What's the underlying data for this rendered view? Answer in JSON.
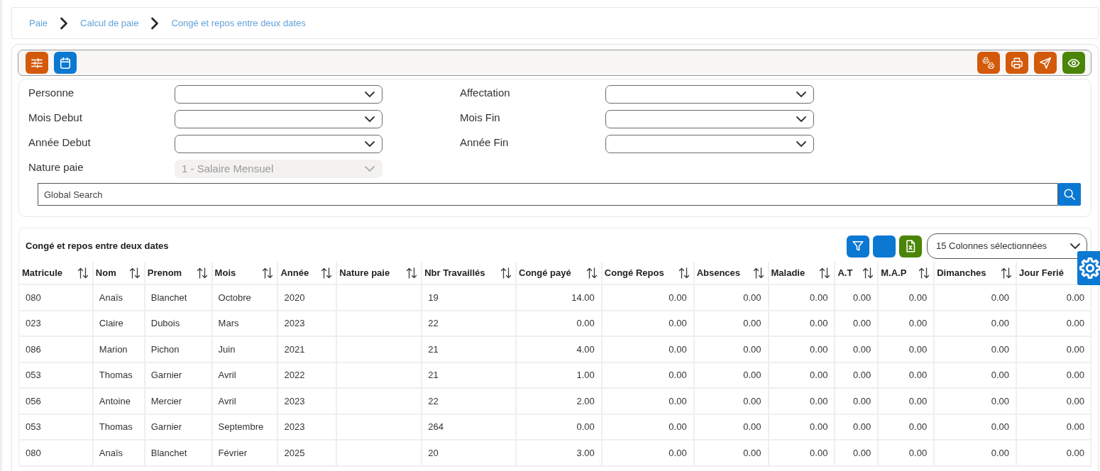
{
  "breadcrumb": [
    {
      "label": "Paie"
    },
    {
      "label": "Calcul de paie"
    },
    {
      "label": "Congé et repos entre deux dates"
    }
  ],
  "toolbar": {
    "left": [
      {
        "kind": "sliders"
      },
      {
        "kind": "calendar"
      }
    ],
    "right": [
      {
        "kind": "print-multi"
      },
      {
        "kind": "print"
      },
      {
        "kind": "send"
      },
      {
        "kind": "view"
      }
    ]
  },
  "filters": [
    {
      "label": "Personne",
      "disabled": false
    },
    {
      "label": "Affectation",
      "disabled": false
    },
    {
      "label": "Mois Debut",
      "disabled": false
    },
    {
      "label": "Mois Fin",
      "disabled": false
    },
    {
      "label": "Année Debut",
      "disabled": false
    },
    {
      "label": "Année Fin",
      "disabled": false
    },
    {
      "label": "Nature paie",
      "value": "1 - Salaire Mensuel",
      "disabled": true
    }
  ],
  "search": {
    "placeholder": "Global Search"
  },
  "table": {
    "title": "Congé et repos entre deux dates",
    "tools": [
      {
        "kind": "filter"
      },
      {
        "kind": "blank"
      },
      {
        "kind": "excel"
      }
    ],
    "column_picker": {
      "value": "15 Colonnes sélectionnées"
    },
    "columns": [
      {
        "label": "Matricule",
        "kind": "text",
        "sortable": true
      },
      {
        "label": "Nom",
        "kind": "text",
        "sortable": true
      },
      {
        "label": "Prenom",
        "kind": "text",
        "sortable": true
      },
      {
        "label": "Mois",
        "kind": "text",
        "sortable": true
      },
      {
        "label": "Année",
        "kind": "text",
        "sortable": true
      },
      {
        "label": "Nature paie",
        "kind": "text",
        "sortable": true
      },
      {
        "label": "Nbr Travaillés",
        "kind": "text",
        "sortable": true
      },
      {
        "label": "Congé payé",
        "kind": "number",
        "sortable": true
      },
      {
        "label": "Congé Repos",
        "kind": "number",
        "sortable": true
      },
      {
        "label": "Absences",
        "kind": "number",
        "sortable": true
      },
      {
        "label": "Maladie",
        "kind": "number",
        "sortable": true
      },
      {
        "label": "A.T",
        "kind": "number",
        "sortable": true
      },
      {
        "label": "M.A.P",
        "kind": "number",
        "sortable": true
      },
      {
        "label": "Dimanches",
        "kind": "number",
        "sortable": true
      },
      {
        "label": "Jour Ferié",
        "kind": "number",
        "sortable": false
      }
    ],
    "rows": [
      [
        "080",
        "Anaïs",
        "Blanchet",
        "Octobre",
        "2020",
        null,
        "19",
        "14.00",
        "0.00",
        "0.00",
        "0.00",
        "0.00",
        "0.00",
        "0.00",
        "0.00"
      ],
      [
        "023",
        "Claire",
        "Dubois",
        "Mars",
        "2023",
        null,
        "22",
        "0.00",
        "0.00",
        "0.00",
        "0.00",
        "0.00",
        "0.00",
        "0.00",
        "0.00"
      ],
      [
        "086",
        "Marion",
        "Pichon",
        "Juin",
        "2021",
        null,
        "21",
        "4.00",
        "0.00",
        "0.00",
        "0.00",
        "0.00",
        "0.00",
        "0.00",
        "0.00"
      ],
      [
        "053",
        "Thomas",
        "Garnier",
        "Avril",
        "2022",
        null,
        "21",
        "1.00",
        "0.00",
        "0.00",
        "0.00",
        "0.00",
        "0.00",
        "0.00",
        "0.00"
      ],
      [
        "056",
        "Antoine",
        "Mercier",
        "Avril",
        "2023",
        null,
        "22",
        "2.00",
        "0.00",
        "0.00",
        "0.00",
        "0.00",
        "0.00",
        "0.00",
        "0.00"
      ],
      [
        "053",
        "Thomas",
        "Garnier",
        "Septembre",
        "2023",
        null,
        "264",
        "0.00",
        "0.00",
        "0.00",
        "0.00",
        "0.00",
        "0.00",
        "0.00",
        "0.00"
      ],
      [
        "080",
        "Anaïs",
        "Blanchet",
        "Février",
        "2025",
        null,
        "20",
        "3.00",
        "0.00",
        "0.00",
        "0.00",
        "0.00",
        "0.00",
        "0.00",
        "0.00"
      ]
    ]
  }
}
